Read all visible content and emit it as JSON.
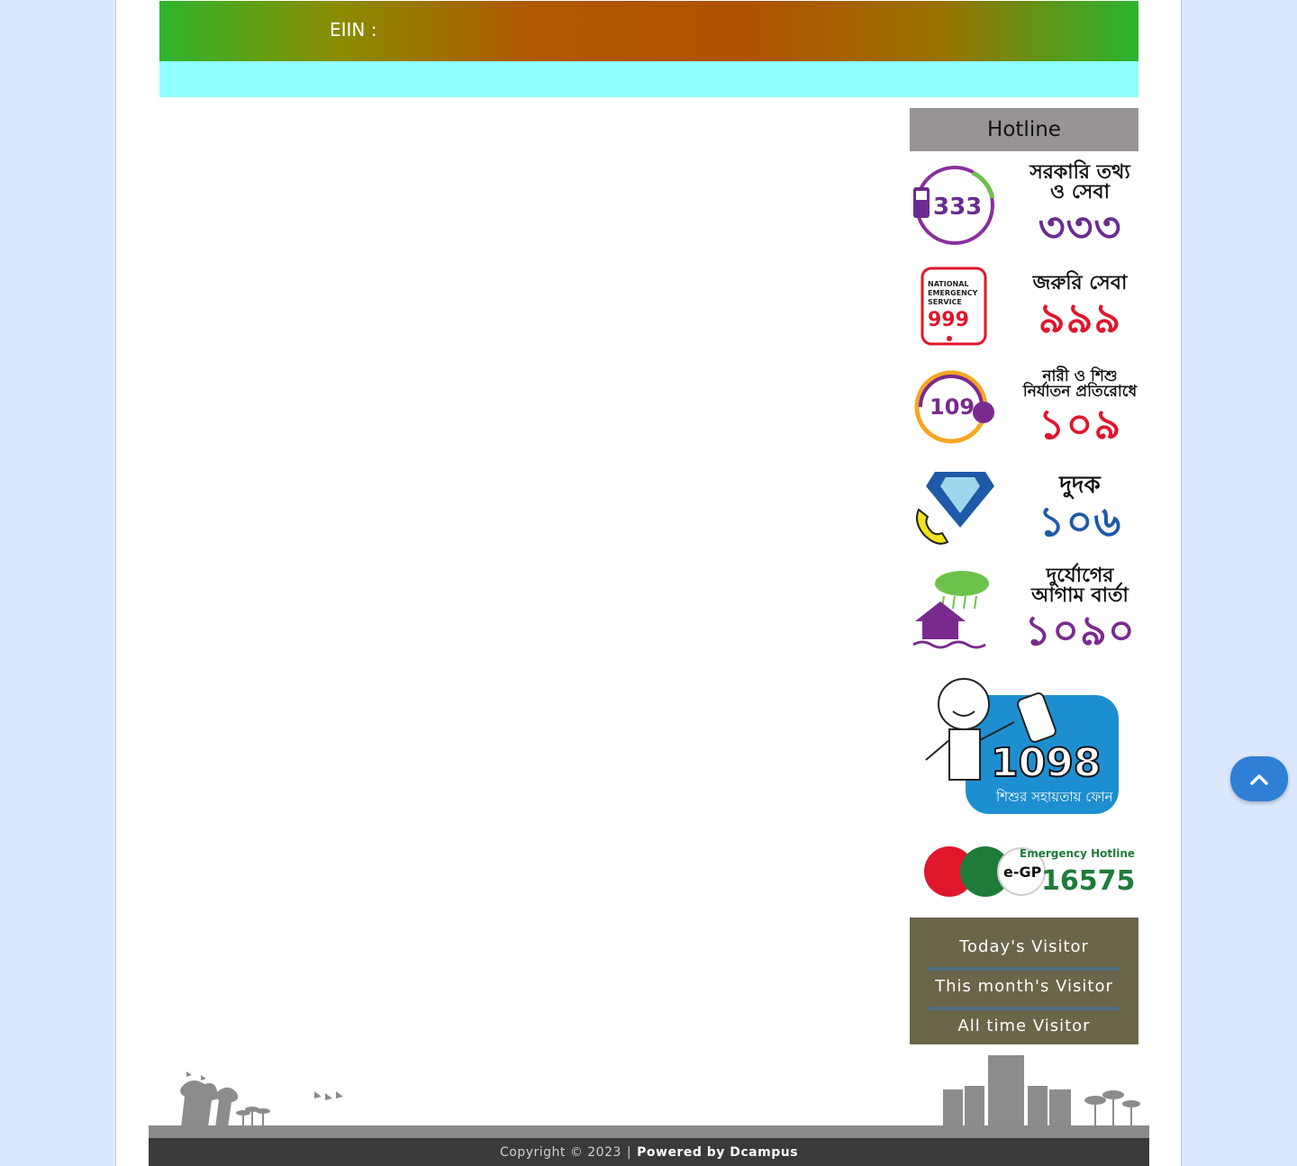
{
  "header": {
    "eiin_label": "EIIN :"
  },
  "sidebar": {
    "hotline_title": "Hotline",
    "hotlines": [
      {
        "icon": "info-service-333-icon",
        "caption": "সরকারি তথ্য ও সেবা",
        "number": "৩৩৩",
        "icon_text": "333",
        "color": "#6a2c91"
      },
      {
        "icon": "emergency-999-icon",
        "caption": "জরুরি সেবা",
        "number": "৯৯৯",
        "icon_text": "999",
        "color": "#e0162b"
      },
      {
        "icon": "women-child-109-icon",
        "caption": "নারী ও শিশু নির্যাতন প্রতিরোধে",
        "number": "১০৯",
        "icon_text": "109",
        "color": "#e0162b"
      },
      {
        "icon": "anti-corruption-106-icon",
        "caption": "দুদক",
        "number": "১০৬",
        "icon_text": "",
        "color": "#1f5aa8"
      },
      {
        "icon": "disaster-warning-1090-icon",
        "caption": "দুর্যোগের আগাম বার্তা",
        "number": "১০৯০",
        "icon_text": "",
        "color": "#7a2a8f"
      }
    ],
    "child_helpline": {
      "number": "1098",
      "caption": "শিশুর সহায়তায় ফোন"
    },
    "egp": {
      "title": "Emergency Hotline",
      "number": "16575",
      "logo_text": "e-GP"
    },
    "visitors": {
      "today": "Today's Visitor",
      "month": "This month's Visitor",
      "all_time": "All time Visitor"
    }
  },
  "footer": {
    "copyright": "Copyright © 2023",
    "separator": "|",
    "powered": "Powered by Dcampus"
  },
  "scroll_top": {
    "icon": "chevron-up-icon"
  }
}
